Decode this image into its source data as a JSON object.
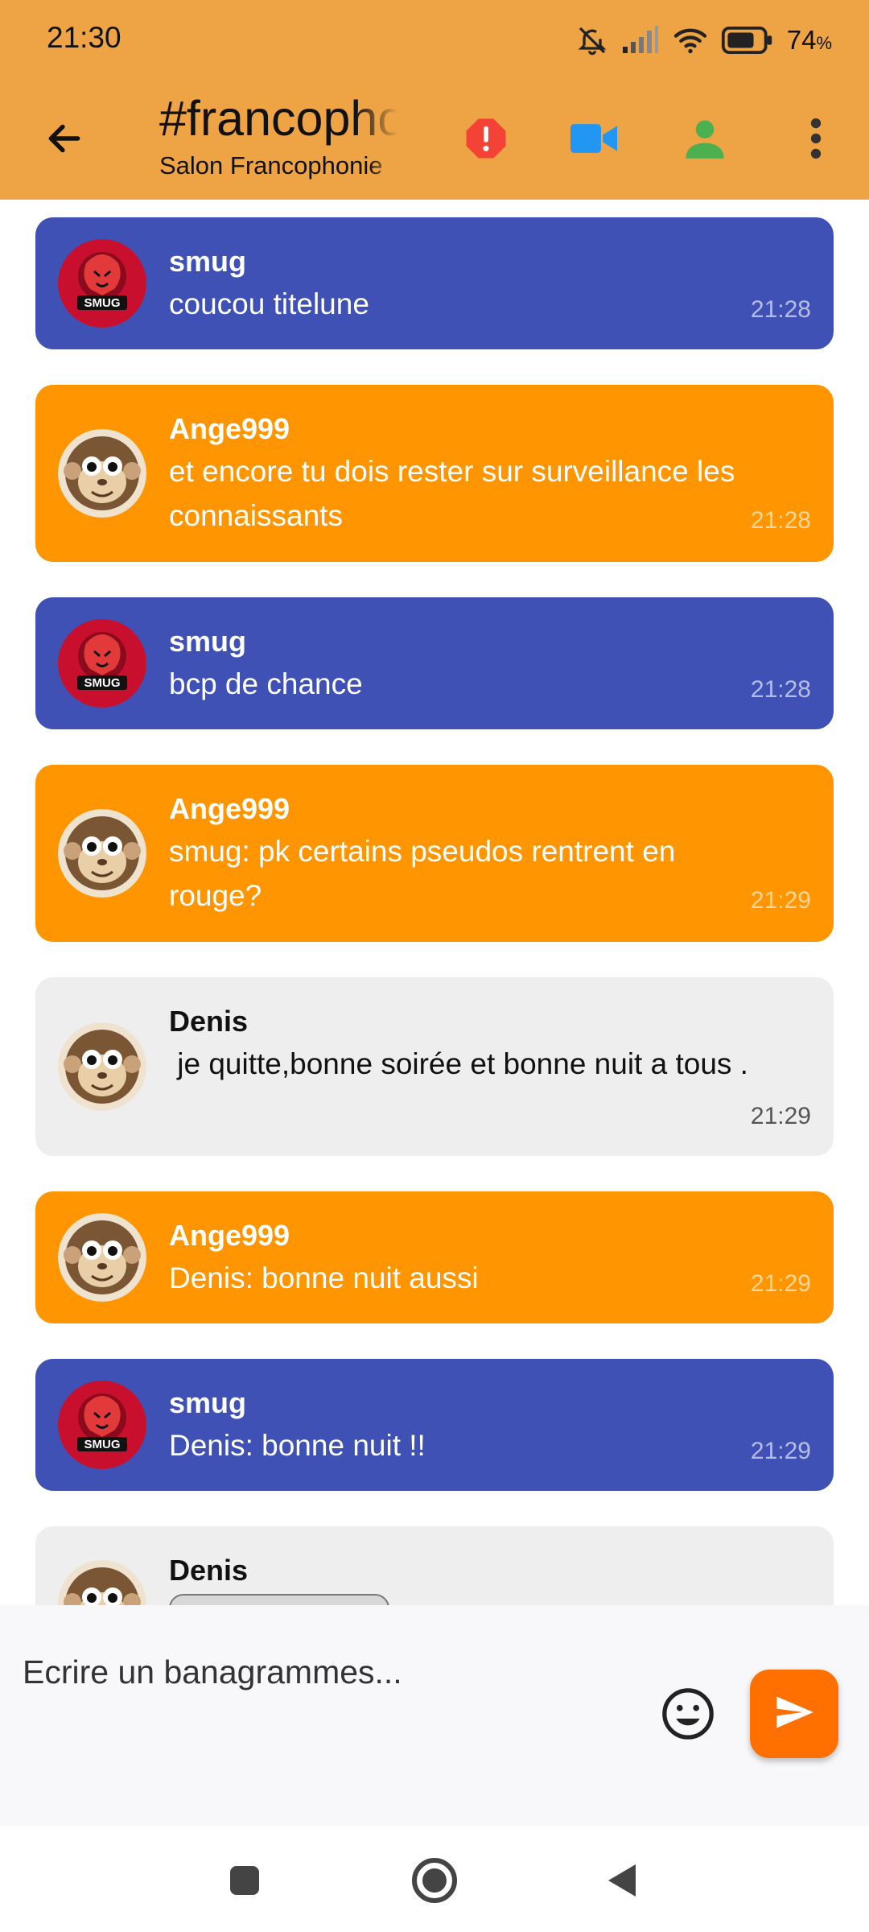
{
  "status_bar": {
    "time": "21:30",
    "battery_percent": "74",
    "battery_unit": "%"
  },
  "header": {
    "title": "#francophonie",
    "subtitle": "Salon Francophonie",
    "icons": [
      "back-arrow-icon",
      "alert-icon",
      "video-call-icon",
      "user-icon",
      "more-vert-icon"
    ],
    "colors": {
      "bar": "#EEA445",
      "alert": "#F44336",
      "video": "#2196F3",
      "user": "#4CAF50"
    }
  },
  "messages": [
    {
      "author": "smug",
      "text": "coucou titelune",
      "time": "21:28",
      "style": "blue",
      "avatar": "lion-avatar"
    },
    {
      "author": "Ange999",
      "text": "et encore tu dois rester sur surveillance les connaissants",
      "time": "21:28",
      "style": "orange",
      "avatar": "monkey-avatar"
    },
    {
      "author": "smug",
      "text": "bcp de chance",
      "time": "21:28",
      "style": "blue",
      "avatar": "lion-avatar"
    },
    {
      "author": "Ange999",
      "text": "smug: pk certains pseudos rentrent en rouge?",
      "time": "21:29",
      "style": "orange",
      "avatar": "monkey-avatar"
    },
    {
      "author": "Denis",
      "text": " je quitte,bonne soirée et bonne nuit a tous .",
      "time": "21:29",
      "style": "grey",
      "avatar": "monkey-avatar"
    },
    {
      "author": "Ange999",
      "text": "Denis: bonne nuit aussi",
      "time": "21:29",
      "style": "orange",
      "avatar": "monkey-avatar"
    },
    {
      "author": "smug",
      "text": "Denis: bonne nuit !!",
      "time": "21:29",
      "style": "blue",
      "avatar": "lion-avatar"
    },
    {
      "author": "Denis",
      "text": "",
      "time": "",
      "style": "grey",
      "avatar": "monkey-avatar"
    }
  ],
  "composer": {
    "placeholder": "Ecrire un banagrammes...",
    "icons": [
      "emoji-icon",
      "send-icon"
    ],
    "send_color": "#FF7000"
  },
  "nav_bar": {
    "icons": [
      "recents-square-icon",
      "home-circle-icon",
      "back-triangle-icon"
    ]
  }
}
